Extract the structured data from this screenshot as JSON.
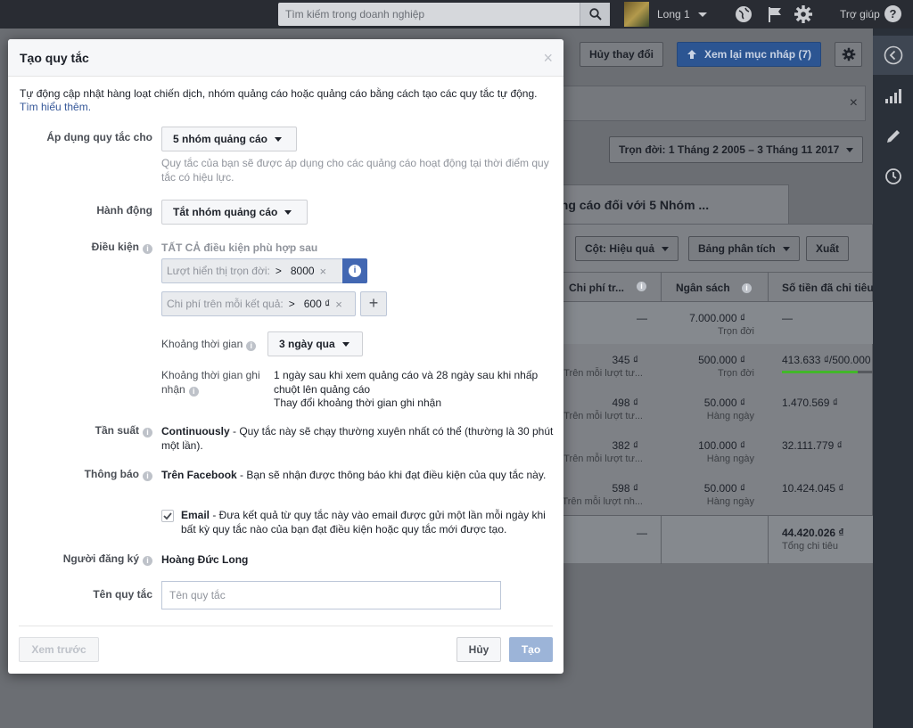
{
  "topbar": {
    "search_placeholder": "Tìm kiếm trong doanh nghiệp",
    "username": "Long 1",
    "help_label": "Trợ giúp",
    "help_icon_glyph": "?"
  },
  "background": {
    "discard_label": "Hủy thay đổi",
    "review_label": "Xem lại mục nháp (7)",
    "date_range": "Trọn đời: 1 Tháng 2 2005 – 3 Tháng 11 2017",
    "close_glyph": "×",
    "tab_label": "ảng cáo đối với 5 Nhóm ...",
    "columns_btn": "Cột: Hiệu quả",
    "breakdown_btn": "Bảng phân tích",
    "export_btn": "Xuất",
    "headers": [
      "Chi phí tr...",
      "Ngân sách",
      "Số tiền đã chi tiêu"
    ],
    "rows": [
      {
        "cost": "—",
        "cost_sub": "",
        "budget": "7.000.000 ₫",
        "budget_sub": "Trọn đời",
        "spent": "—",
        "spent_sub": ""
      },
      {
        "cost": "345 ₫",
        "cost_sub": "Trên mỗi lượt tư...",
        "budget": "500.000 ₫",
        "budget_sub": "Trọn đời",
        "spent": "413.633 ₫/500.000",
        "spent_sub": ""
      },
      {
        "cost": "498 ₫",
        "cost_sub": "Trên mỗi lượt tư...",
        "budget": "50.000 ₫",
        "budget_sub": "Hàng ngày",
        "spent": "1.470.569 ₫",
        "spent_sub": ""
      },
      {
        "cost": "382 ₫",
        "cost_sub": "Trên mỗi lượt tư...",
        "budget": "100.000 ₫",
        "budget_sub": "Hàng ngày",
        "spent": "32.111.779 ₫",
        "spent_sub": ""
      },
      {
        "cost": "598 ₫",
        "cost_sub": "Trên mỗi lượt nh...",
        "budget": "50.000 ₫",
        "budget_sub": "Hàng ngày",
        "spent": "10.424.045 ₫",
        "spent_sub": ""
      }
    ],
    "total": {
      "cost": "—",
      "spent": "44.420.026 ₫",
      "spent_sub": "Tổng chi tiêu"
    },
    "progress_fraction": 0.827
  },
  "modal": {
    "title": "Tạo quy tắc",
    "close_glyph": "×",
    "intro": "Tự động cập nhật hàng loạt chiến dịch, nhóm quảng cáo hoặc quảng cáo bằng cách tạo các quy tắc tự động.",
    "learn_more": "Tìm hiểu thêm.",
    "apply_label": "Áp dụng quy tắc cho",
    "apply_value": "5 nhóm quảng cáo",
    "apply_help": "Quy tắc của bạn sẽ được áp dụng cho các quảng cáo hoạt động tại thời điểm quy tắc có hiệu lực.",
    "action_label": "Hành động",
    "action_value": "Tắt nhóm quảng cáo",
    "conditions_label": "Điều kiện",
    "conditions_header": "TẤT CẢ điều kiện phù hợp sau",
    "conditions": [
      {
        "name": "Lượt hiển thị trọn đời:",
        "operator": ">",
        "value": "8000"
      },
      {
        "name": "Chi phí trên mỗi kết quả:",
        "operator": ">",
        "value": "600 ₫"
      }
    ],
    "remove_glyph": "×",
    "add_glyph": "+",
    "info_glyph": "i",
    "timerange_label": "Khoảng thời gian",
    "timerange_value": "3 ngày qua",
    "attribution_label": "Khoảng thời gian ghi nhận",
    "attribution_text": "1 ngày sau khi xem quảng cáo và 28 ngày sau khi nhấp chuột lên quảng cáo",
    "attribution_link": "Thay đổi khoảng thời gian ghi nhận",
    "frequency_label": "Tần suất",
    "frequency_bold": "Continuously",
    "frequency_text": " - Quy tắc này sẽ chạy thường xuyên nhất có thể (thường là 30 phút một lần).",
    "notify_label": "Thông báo",
    "notify_bold": "Trên Facebook",
    "notify_text": " - Bạn sẽ nhận được thông báo khi đạt điều kiện của quy tắc này.",
    "email_bold": "Email",
    "email_text": " - Đưa kết quả từ quy tắc này vào email được gửi một lần mỗi ngày khi bất kỳ quy tắc nào của bạn đạt điều kiện hoặc quy tắc mới được tạo.",
    "email_checked": true,
    "subscriber_label": "Người đăng ký",
    "subscriber_value": "Hoàng Đức Long",
    "name_label": "Tên quy tắc",
    "name_placeholder": "Tên quy tắc",
    "name_value": "",
    "preview_btn": "Xem trước",
    "cancel_btn": "Hủy",
    "create_btn": "Tạo"
  },
  "colors": {
    "accent": "#4267b2",
    "create_btn_disabled": "#9cb4d8",
    "link": "#365899",
    "progress": "#42b72a"
  },
  "icons": {
    "search": "search-icon",
    "globe": "globe-icon",
    "flag": "flag-icon",
    "gear": "gear-icon",
    "back": "chevron-left-icon",
    "bars": "bar-chart-icon",
    "pencil": "pencil-icon",
    "clock": "clock-icon"
  }
}
